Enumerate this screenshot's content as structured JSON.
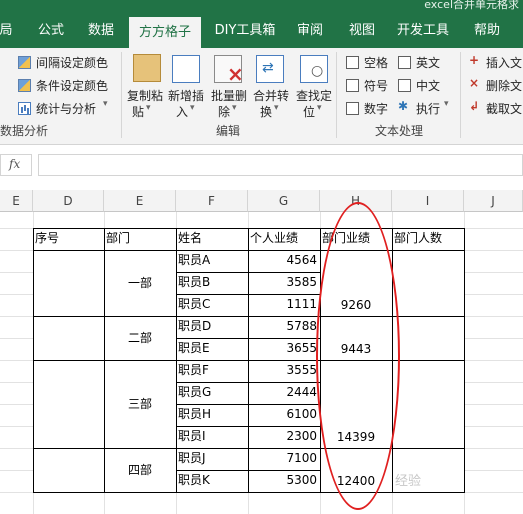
{
  "titlebar": {
    "title": "excel合并单元格求"
  },
  "tabs": [
    {
      "label": "局",
      "active": false
    },
    {
      "label": "公式",
      "active": false
    },
    {
      "label": "数据",
      "active": false
    },
    {
      "label": "方方格子",
      "active": true
    },
    {
      "label": "DIY工具箱",
      "active": false
    },
    {
      "label": "审阅",
      "active": false
    },
    {
      "label": "视图",
      "active": false
    },
    {
      "label": "开发工具",
      "active": false
    },
    {
      "label": "帮助",
      "active": false
    }
  ],
  "ribbon": {
    "data_analysis": {
      "items": [
        "间隔设定颜色",
        "条件设定颜色",
        "统计与分析"
      ],
      "group_label": "数据分析"
    },
    "edit": {
      "buttons": [
        {
          "line1": "复制粘",
          "line2": "贴"
        },
        {
          "line1": "新增插",
          "line2": "入"
        },
        {
          "line1": "批量删",
          "line2": "除"
        },
        {
          "line1": "合并转",
          "line2": "换"
        },
        {
          "line1": "查找定",
          "line2": "位"
        }
      ],
      "group_label": "编辑"
    },
    "text": {
      "checkboxes": [
        "空格",
        "英文",
        "符号",
        "中文",
        "数字"
      ],
      "execute": "执行",
      "group_label": "文本处理"
    },
    "right": {
      "items": [
        "插入文",
        "删除文",
        "截取文"
      ]
    }
  },
  "formula_bar": {
    "fx": "fx",
    "value": ""
  },
  "columns": [
    "E",
    "D",
    "E",
    "F",
    "G",
    "H",
    "I",
    "J"
  ],
  "table": {
    "headers": [
      "序号",
      "部门",
      "姓名",
      "个人业绩",
      "部门业绩",
      "部门人数"
    ],
    "names": [
      "职员A",
      "职员B",
      "职员C",
      "职员D",
      "职员E",
      "职员F",
      "职员G",
      "职员H",
      "职员I",
      "职员J",
      "职员K"
    ],
    "scores": [
      "4564",
      "3585",
      "1111",
      "5788",
      "3655",
      "3555",
      "2444",
      "6100",
      "2300",
      "7100",
      "5300"
    ],
    "departments": [
      "一部",
      "二部",
      "三部",
      "四部"
    ],
    "dept_totals": [
      "9260",
      "9443",
      "14399",
      "12400"
    ]
  },
  "watermark": "经验"
}
